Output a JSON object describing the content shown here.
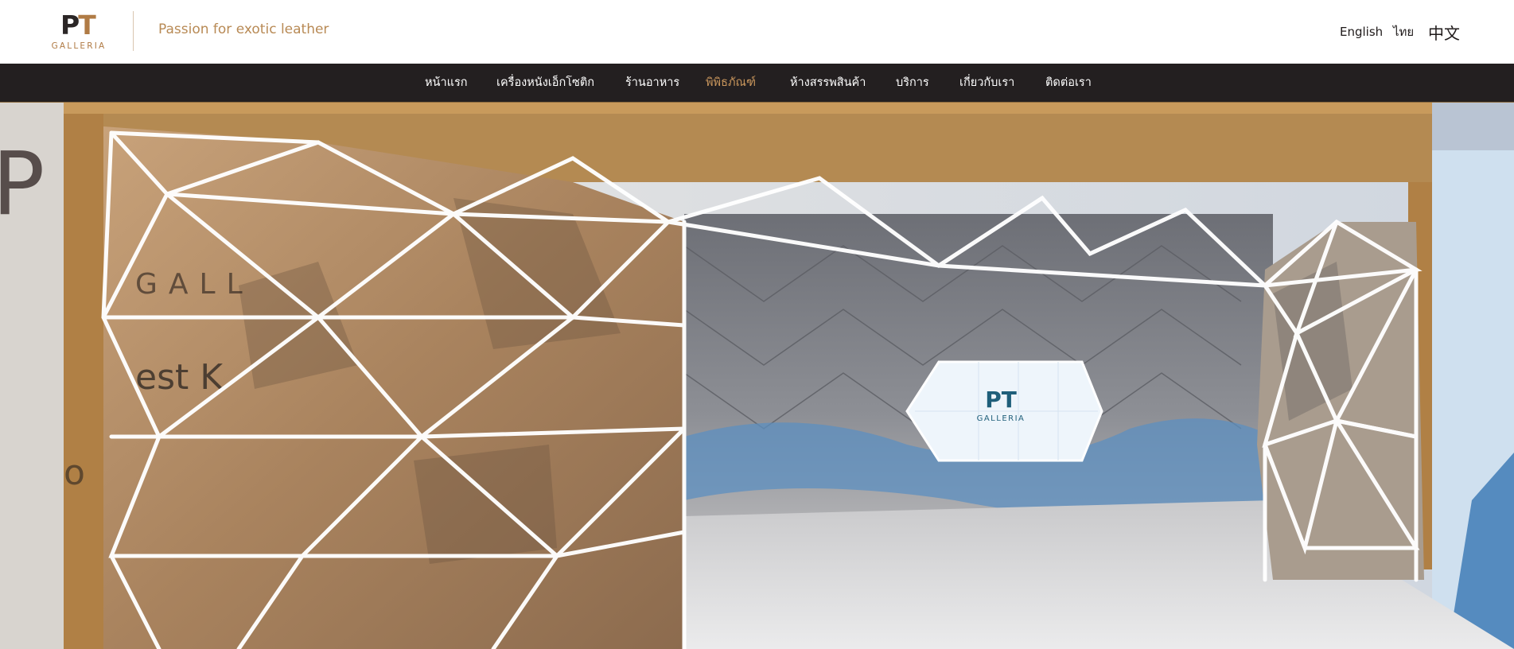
{
  "header": {
    "logo": {
      "letters_p": "P",
      "letters_t": "T",
      "sub": "GALLERIA"
    },
    "tagline": "Passion for exotic leather",
    "languages": [
      "English",
      "ไทย",
      "中文"
    ]
  },
  "nav": {
    "items": [
      "หน้าแรก",
      "เครื่องหนังเอ็กโซติก",
      "ร้านอาหาร",
      "พิพิธภัณฑ์",
      "ห้างสรรพสินค้า",
      "บริการ",
      "เกี่ยวกับเรา",
      "ติดต่อเรา"
    ],
    "active_index": 3
  },
  "hero": {
    "screen_logo": "PT",
    "screen_sub": "GALLERIA",
    "wall_text": [
      "GALL",
      "est K",
      "o"
    ]
  },
  "colors": {
    "nav_bg": "#231f20",
    "accent": "#b07b45",
    "active": "#c9965c"
  }
}
